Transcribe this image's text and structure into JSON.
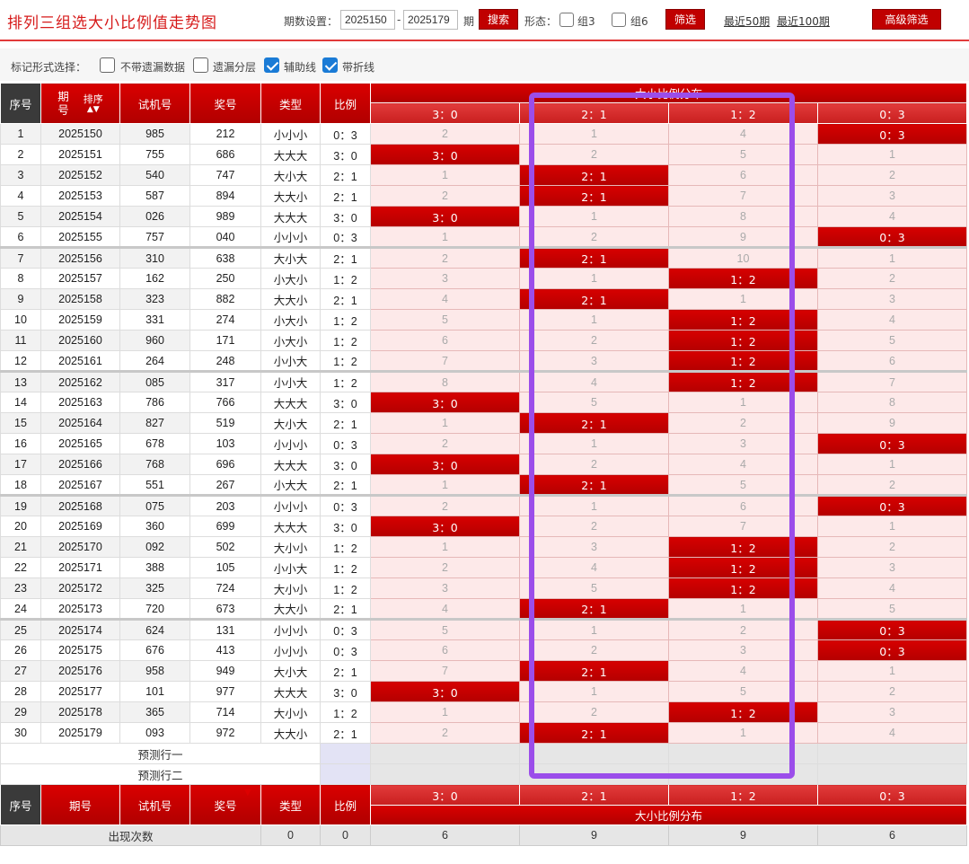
{
  "title": "排列三组选大小比例值走势图",
  "filters": {
    "period_label": "期数设置：",
    "period_start": "2025150",
    "dash": "-",
    "period_end": "2025179",
    "period_unit": "期",
    "search_label": "搜索",
    "form_label": "形态：",
    "group3_label": "组3",
    "group6_label": "组6",
    "filter_label": "筛选",
    "recent50_label": "最近50期",
    "recent100_label": "最近100期",
    "advanced_label": "高级筛选"
  },
  "mark_options": {
    "label": "标记形式选择：",
    "items": [
      {
        "label": "不带遗漏数据",
        "checked": false
      },
      {
        "label": "遗漏分层",
        "checked": false
      },
      {
        "label": "辅助线",
        "checked": true
      },
      {
        "label": "带折线",
        "checked": true
      }
    ]
  },
  "header": {
    "seq": "序号",
    "period": "期号",
    "period_top": "期",
    "period_bottom": "号",
    "sort": "排序",
    "trial": "试机号",
    "prize": "奖号",
    "type": "类型",
    "ratio": "比例",
    "dist": "大小比例分布",
    "dist_cols": [
      "3：0",
      "2：1",
      "1：2",
      "0：3"
    ]
  },
  "rows": [
    {
      "seq": "1",
      "period": "2025150",
      "trial": "985",
      "prize": "212",
      "type": "小小小",
      "ratio": "0：3",
      "cells": [
        "2",
        "1",
        "4",
        "0：3"
      ],
      "hit": 3
    },
    {
      "seq": "2",
      "period": "2025151",
      "trial": "755",
      "prize": "686",
      "type": "大大大",
      "ratio": "3：0",
      "cells": [
        "3：0",
        "2",
        "5",
        "1"
      ],
      "hit": 0
    },
    {
      "seq": "3",
      "period": "2025152",
      "trial": "540",
      "prize": "747",
      "type": "大小大",
      "ratio": "2：1",
      "cells": [
        "1",
        "2：1",
        "6",
        "2"
      ],
      "hit": 1
    },
    {
      "seq": "4",
      "period": "2025153",
      "trial": "587",
      "prize": "894",
      "type": "大大小",
      "ratio": "2：1",
      "cells": [
        "2",
        "2：1",
        "7",
        "3"
      ],
      "hit": 1
    },
    {
      "seq": "5",
      "period": "2025154",
      "trial": "026",
      "prize": "989",
      "type": "大大大",
      "ratio": "3：0",
      "cells": [
        "3：0",
        "1",
        "8",
        "4"
      ],
      "hit": 0
    },
    {
      "seq": "6",
      "period": "2025155",
      "trial": "757",
      "prize": "040",
      "type": "小小小",
      "ratio": "0：3",
      "cells": [
        "1",
        "2",
        "9",
        "0：3"
      ],
      "hit": 3
    },
    {
      "seq": "7",
      "period": "2025156",
      "trial": "310",
      "prize": "638",
      "type": "大小大",
      "ratio": "2：1",
      "cells": [
        "2",
        "2：1",
        "10",
        "1"
      ],
      "hit": 1
    },
    {
      "seq": "8",
      "period": "2025157",
      "trial": "162",
      "prize": "250",
      "type": "小大小",
      "ratio": "1：2",
      "cells": [
        "3",
        "1",
        "1：2",
        "2"
      ],
      "hit": 2
    },
    {
      "seq": "9",
      "period": "2025158",
      "trial": "323",
      "prize": "882",
      "type": "大大小",
      "ratio": "2：1",
      "cells": [
        "4",
        "2：1",
        "1",
        "3"
      ],
      "hit": 1
    },
    {
      "seq": "10",
      "period": "2025159",
      "trial": "331",
      "prize": "274",
      "type": "小大小",
      "ratio": "1：2",
      "cells": [
        "5",
        "1",
        "1：2",
        "4"
      ],
      "hit": 2
    },
    {
      "seq": "11",
      "period": "2025160",
      "trial": "960",
      "prize": "171",
      "type": "小大小",
      "ratio": "1：2",
      "cells": [
        "6",
        "2",
        "1：2",
        "5"
      ],
      "hit": 2
    },
    {
      "seq": "12",
      "period": "2025161",
      "trial": "264",
      "prize": "248",
      "type": "小小大",
      "ratio": "1：2",
      "cells": [
        "7",
        "3",
        "1：2",
        "6"
      ],
      "hit": 2
    },
    {
      "seq": "13",
      "period": "2025162",
      "trial": "085",
      "prize": "317",
      "type": "小小大",
      "ratio": "1：2",
      "cells": [
        "8",
        "4",
        "1：2",
        "7"
      ],
      "hit": 2
    },
    {
      "seq": "14",
      "period": "2025163",
      "trial": "786",
      "prize": "766",
      "type": "大大大",
      "ratio": "3：0",
      "cells": [
        "3：0",
        "5",
        "1",
        "8"
      ],
      "hit": 0
    },
    {
      "seq": "15",
      "period": "2025164",
      "trial": "827",
      "prize": "519",
      "type": "大小大",
      "ratio": "2：1",
      "cells": [
        "1",
        "2：1",
        "2",
        "9"
      ],
      "hit": 1
    },
    {
      "seq": "16",
      "period": "2025165",
      "trial": "678",
      "prize": "103",
      "type": "小小小",
      "ratio": "0：3",
      "cells": [
        "2",
        "1",
        "3",
        "0：3"
      ],
      "hit": 3
    },
    {
      "seq": "17",
      "period": "2025166",
      "trial": "768",
      "prize": "696",
      "type": "大大大",
      "ratio": "3：0",
      "cells": [
        "3：0",
        "2",
        "4",
        "1"
      ],
      "hit": 0
    },
    {
      "seq": "18",
      "period": "2025167",
      "trial": "551",
      "prize": "267",
      "type": "小大大",
      "ratio": "2：1",
      "cells": [
        "1",
        "2：1",
        "5",
        "2"
      ],
      "hit": 1
    },
    {
      "seq": "19",
      "period": "2025168",
      "trial": "075",
      "prize": "203",
      "type": "小小小",
      "ratio": "0：3",
      "cells": [
        "2",
        "1",
        "6",
        "0：3"
      ],
      "hit": 3
    },
    {
      "seq": "20",
      "period": "2025169",
      "trial": "360",
      "prize": "699",
      "type": "大大大",
      "ratio": "3：0",
      "cells": [
        "3：0",
        "2",
        "7",
        "1"
      ],
      "hit": 0
    },
    {
      "seq": "21",
      "period": "2025170",
      "trial": "092",
      "prize": "502",
      "type": "大小小",
      "ratio": "1：2",
      "cells": [
        "1",
        "3",
        "1：2",
        "2"
      ],
      "hit": 2
    },
    {
      "seq": "22",
      "period": "2025171",
      "trial": "388",
      "prize": "105",
      "type": "小小大",
      "ratio": "1：2",
      "cells": [
        "2",
        "4",
        "1：2",
        "3"
      ],
      "hit": 2
    },
    {
      "seq": "23",
      "period": "2025172",
      "trial": "325",
      "prize": "724",
      "type": "大小小",
      "ratio": "1：2",
      "cells": [
        "3",
        "5",
        "1：2",
        "4"
      ],
      "hit": 2
    },
    {
      "seq": "24",
      "period": "2025173",
      "trial": "720",
      "prize": "673",
      "type": "大大小",
      "ratio": "2：1",
      "cells": [
        "4",
        "2：1",
        "1",
        "5"
      ],
      "hit": 1
    },
    {
      "seq": "25",
      "period": "2025174",
      "trial": "624",
      "prize": "131",
      "type": "小小小",
      "ratio": "0：3",
      "cells": [
        "5",
        "1",
        "2",
        "0：3"
      ],
      "hit": 3
    },
    {
      "seq": "26",
      "period": "2025175",
      "trial": "676",
      "prize": "413",
      "type": "小小小",
      "ratio": "0：3",
      "cells": [
        "6",
        "2",
        "3",
        "0：3"
      ],
      "hit": 3
    },
    {
      "seq": "27",
      "period": "2025176",
      "trial": "958",
      "prize": "949",
      "type": "大小大",
      "ratio": "2：1",
      "cells": [
        "7",
        "2：1",
        "4",
        "1"
      ],
      "hit": 1
    },
    {
      "seq": "28",
      "period": "2025177",
      "trial": "101",
      "prize": "977",
      "type": "大大大",
      "ratio": "3：0",
      "cells": [
        "3：0",
        "1",
        "5",
        "2"
      ],
      "hit": 0
    },
    {
      "seq": "29",
      "period": "2025178",
      "trial": "365",
      "prize": "714",
      "type": "大小小",
      "ratio": "1：2",
      "cells": [
        "1",
        "2",
        "1：2",
        "3"
      ],
      "hit": 2
    },
    {
      "seq": "30",
      "period": "2025179",
      "trial": "093",
      "prize": "972",
      "type": "大大小",
      "ratio": "2：1",
      "cells": [
        "2",
        "2：1",
        "1",
        "4"
      ],
      "hit": 1
    }
  ],
  "predict": [
    "预测行一",
    "预测行二"
  ],
  "stats": {
    "label": "出现次数",
    "type_val": "0",
    "ratio_val": "0",
    "values": [
      "6",
      "9",
      "9",
      "6"
    ]
  },
  "colors": {
    "accent": "#c00000",
    "highlight_box": "#9b4dea",
    "miss_cell": "#fde9e9"
  }
}
